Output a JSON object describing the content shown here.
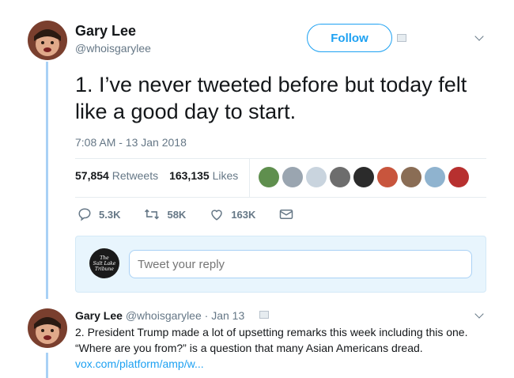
{
  "tweet": {
    "author_name": "Gary Lee",
    "author_handle": "@whoisgarylee",
    "follow_label": "Follow",
    "text": "1. I’ve never tweeted before but today felt like a good day to start.",
    "timestamp": "7:08 AM - 13 Jan 2018",
    "retweets_count": "57,854",
    "retweets_label": "Retweets",
    "likes_count": "163,135",
    "likes_label": "Likes",
    "likers": [
      {
        "icon": "avatar-landscape",
        "color": "#5f8f4e"
      },
      {
        "icon": "avatar-default-egg",
        "color": "#9aa5b0"
      },
      {
        "icon": "avatar-city",
        "color": "#c9d4de"
      },
      {
        "icon": "avatar-person-glasses",
        "color": "#6d6d6d"
      },
      {
        "icon": "avatar-dark",
        "color": "#2b2b2b"
      },
      {
        "icon": "avatar-person",
        "color": "#c8553d"
      },
      {
        "icon": "avatar-person-bearded",
        "color": "#8a6d55"
      },
      {
        "icon": "avatar-sky",
        "color": "#8fb3cf"
      },
      {
        "icon": "avatar-person-red",
        "color": "#b7302f"
      }
    ],
    "actions": {
      "reply_count": "5.3K",
      "retweet_count": "58K",
      "like_count": "163K"
    }
  },
  "reply_box": {
    "placeholder": "Tweet your reply",
    "logo_text": "The Salt Lake Tribune"
  },
  "reply_tweet": {
    "author_name": "Gary Lee",
    "meta": "@whoisgarylee · Jan 13",
    "text": "2. President Trump made a lot of upsetting remarks this week including this one. “Where are you from?” is a question that many Asian Americans dread.",
    "link": "vox.com/platform/amp/w..."
  },
  "colors": {
    "accent": "#1da1f2",
    "thread_line": "#a9d1f5",
    "secondary_text": "#657786"
  }
}
